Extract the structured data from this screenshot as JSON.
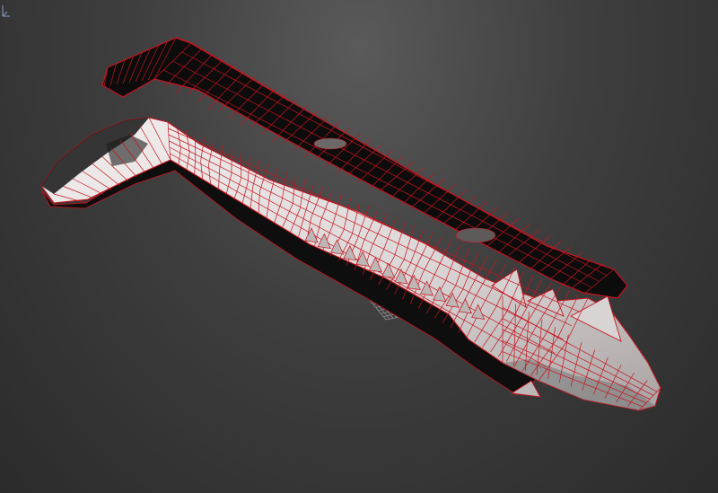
{
  "viewport": {
    "background_top": "#5a5a5a",
    "background_bottom": "#2b2b2b"
  },
  "mesh": {
    "wire_color": "#c4141e",
    "dark_surface": "#0c0c0c",
    "light_surface": "#e8e4e4",
    "shadow_surface": "#8f8a8a",
    "grid_color": "#b0b0b0"
  },
  "gizmo": {
    "icon": "axis-tripod-icon"
  }
}
